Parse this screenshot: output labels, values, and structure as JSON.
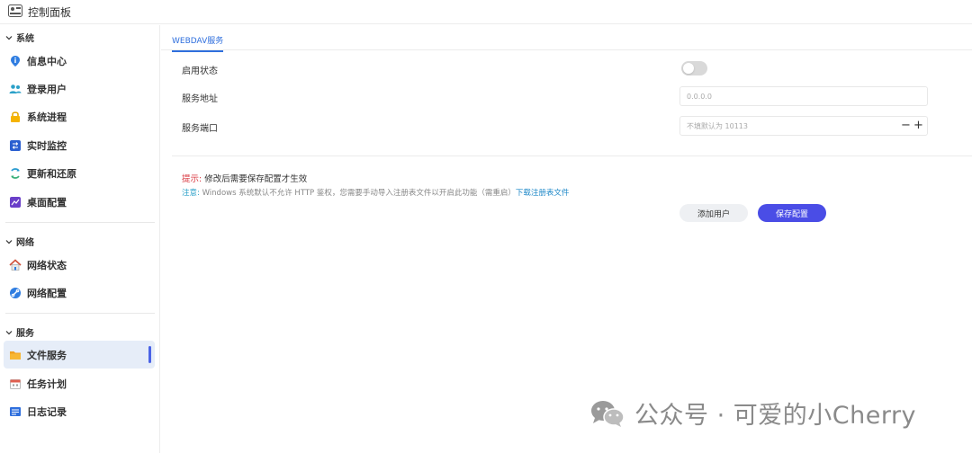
{
  "window": {
    "title": "控制面板"
  },
  "sidebar": {
    "sections": [
      {
        "label": "系统",
        "items": [
          {
            "label": "信息中心",
            "icon": "info-icon"
          },
          {
            "label": "登录用户",
            "icon": "users-icon"
          },
          {
            "label": "系统进程",
            "icon": "lock-icon"
          },
          {
            "label": "实时监控",
            "icon": "monitor-icon"
          },
          {
            "label": "更新和还原",
            "icon": "refresh-icon"
          },
          {
            "label": "桌面配置",
            "icon": "desktop-icon"
          }
        ]
      },
      {
        "label": "网络",
        "items": [
          {
            "label": "网络状态",
            "icon": "home-network-icon"
          },
          {
            "label": "网络配置",
            "icon": "link-icon"
          }
        ]
      },
      {
        "label": "服务",
        "items": [
          {
            "label": "文件服务",
            "icon": "folder-icon",
            "active": true
          },
          {
            "label": "任务计划",
            "icon": "calendar-icon"
          },
          {
            "label": "日志记录",
            "icon": "log-icon"
          }
        ]
      }
    ]
  },
  "main": {
    "tab": "WEBDAV服务",
    "fields": {
      "status_label": "启用状态",
      "status_enabled": false,
      "address_label": "服务地址",
      "address_placeholder": "0.0.0.0",
      "port_label": "服务端口",
      "port_placeholder": "不填默认为 10113",
      "port_minus": "−",
      "port_plus": "+"
    },
    "tip": {
      "prefix": "提示:",
      "text": " 修改后需要保存配置才生效"
    },
    "note": {
      "prefix": "注意:",
      "text": " Windows 系统默认不允许 HTTP 鉴权，您需要手动导入注册表文件以开启此功能（需重启）",
      "link": "下载注册表文件"
    },
    "buttons": {
      "add_user": "添加用户",
      "save_config": "保存配置"
    }
  },
  "watermark": {
    "text": "公众号 · 可爱的小Cherry"
  },
  "colors": {
    "accent": "#4a4de6",
    "link": "#1e88c8",
    "tip": "#d9363e",
    "active_bg": "#e6edf8"
  }
}
